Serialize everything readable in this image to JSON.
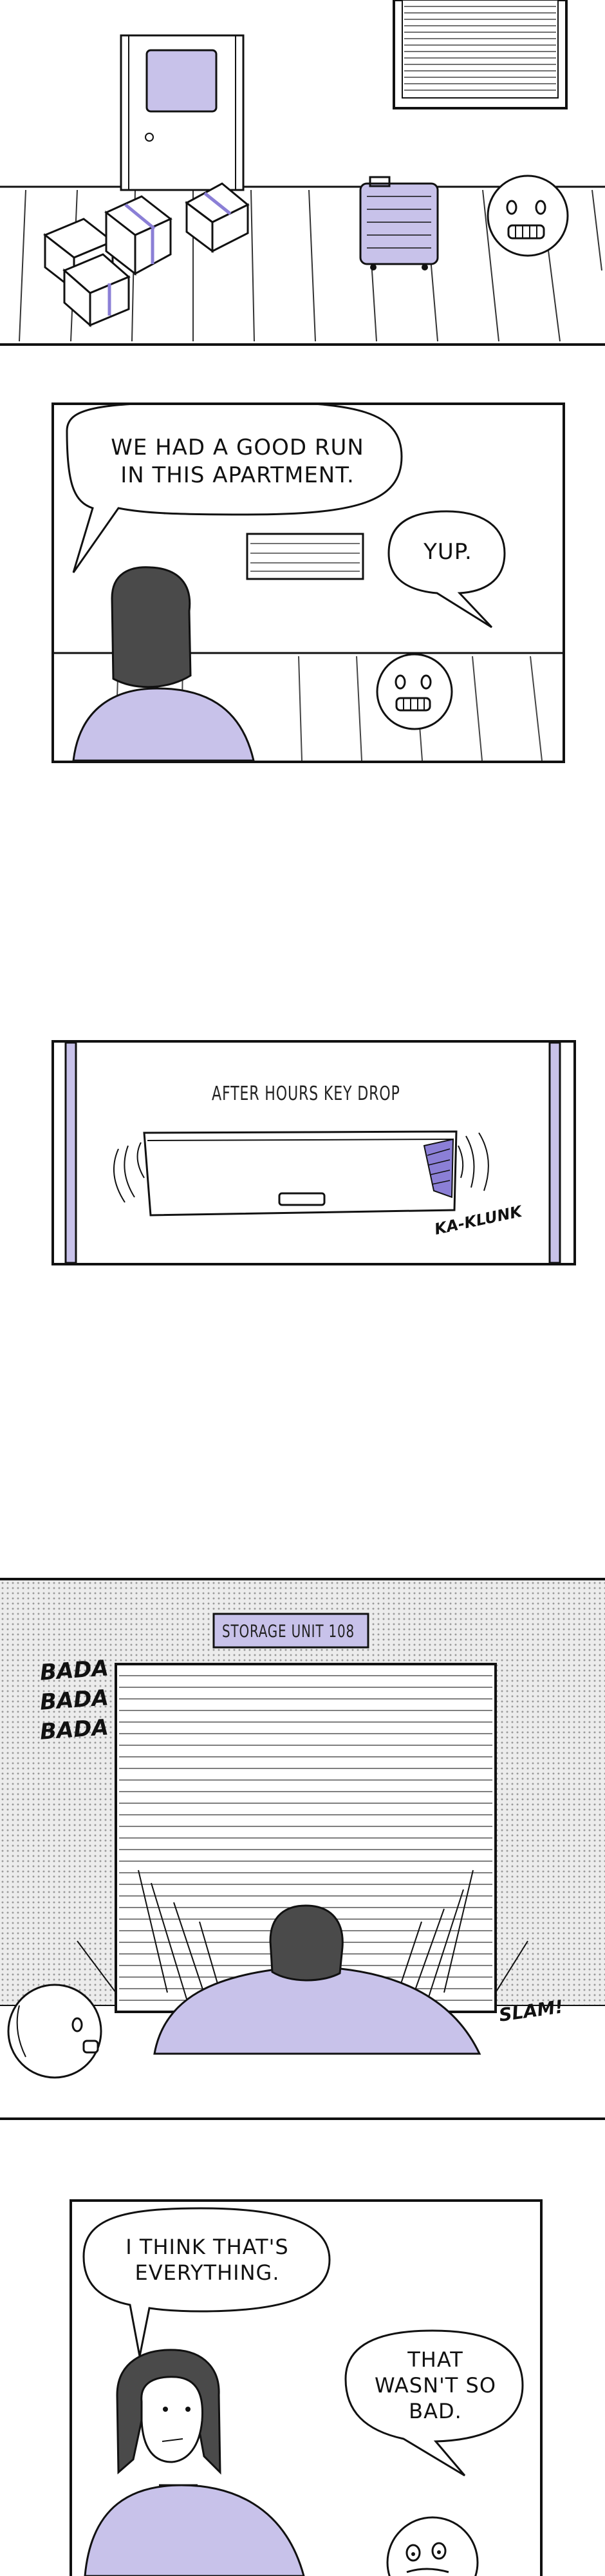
{
  "colors": {
    "accent_lavender": "#c8c2ea",
    "ink": "#111111",
    "halftone_gray": "#d9d9d9"
  },
  "panel1": {
    "icons": [
      "door-icon",
      "cardboard-box-icon",
      "suitcase-icon",
      "worried-face-icon",
      "window-blinds-icon"
    ]
  },
  "panel2": {
    "speech_left": "WE HAD A GOOD RUN\nIN THIS APARTMENT.",
    "speech_right": "YUP."
  },
  "panel3": {
    "sign": "AFTER HOURS KEY DROP",
    "sfx": "KA-KLUNK"
  },
  "panel4": {
    "sign": "STORAGE UNIT 108",
    "sfx_left": [
      "BADA",
      "BADA",
      "BADA"
    ],
    "sfx_right": "SLAM!"
  },
  "panel5": {
    "speech_left": "I THINK THAT'S\nEVERYTHING.",
    "speech_right": "THAT\nWASN'T SO\nBAD."
  }
}
